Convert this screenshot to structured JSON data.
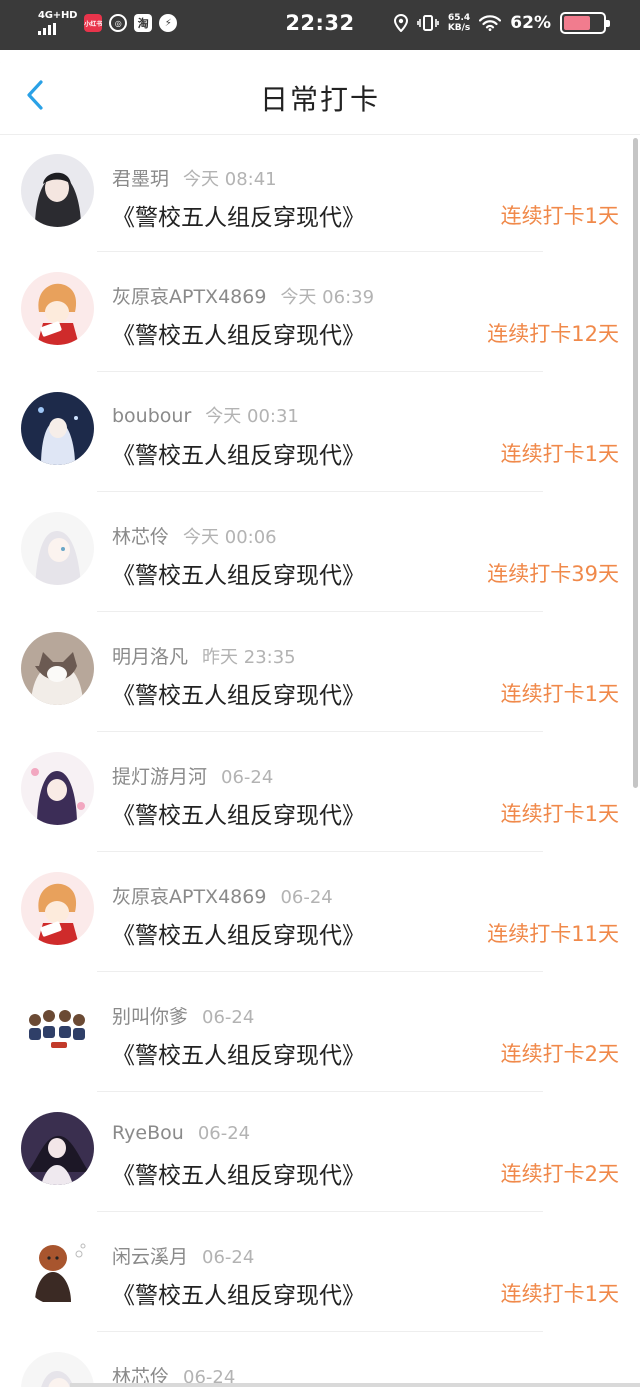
{
  "status_bar": {
    "network": "4G+HD",
    "app_icons": [
      "小红书",
      "◎",
      "淘",
      "⚡"
    ],
    "time": "22:32",
    "speed_value": "65.4",
    "speed_unit": "KB/s",
    "battery_pct": "62%"
  },
  "header": {
    "title": "日常打卡",
    "back_icon": "chevron-left-icon"
  },
  "colors": {
    "accent": "#2aa1e6",
    "streak": "#f0894a",
    "username": "#8a8a8a",
    "time": "#b3b3b3"
  },
  "entries": [
    {
      "user": "君墨玥",
      "time": "今天 08:41",
      "book": "《警校五人组反穿现代》",
      "streak": "连续打卡1天"
    },
    {
      "user": "灰原哀APTX4869",
      "time": "今天 06:39",
      "book": "《警校五人组反穿现代》",
      "streak": "连续打卡12天"
    },
    {
      "user": "boubour",
      "time": "今天 00:31",
      "book": "《警校五人组反穿现代》",
      "streak": "连续打卡1天"
    },
    {
      "user": "林芯伶",
      "time": "今天 00:06",
      "book": "《警校五人组反穿现代》",
      "streak": "连续打卡39天"
    },
    {
      "user": "明月洛凡",
      "time": "昨天 23:35",
      "book": "《警校五人组反穿现代》",
      "streak": "连续打卡1天"
    },
    {
      "user": "提灯游月河",
      "time": "06-24",
      "book": "《警校五人组反穿现代》",
      "streak": "连续打卡1天"
    },
    {
      "user": "灰原哀APTX4869",
      "time": "06-24",
      "book": "《警校五人组反穿现代》",
      "streak": "连续打卡11天"
    },
    {
      "user": "别叫你爹",
      "time": "06-24",
      "book": "《警校五人组反穿现代》",
      "streak": "连续打卡2天"
    },
    {
      "user": "RyeBou",
      "time": "06-24",
      "book": "《警校五人组反穿现代》",
      "streak": "连续打卡2天"
    },
    {
      "user": "闲云溪月",
      "time": "06-24",
      "book": "《警校五人组反穿现代》",
      "streak": "连续打卡1天"
    },
    {
      "user": "林芯伶",
      "time": "06-24",
      "book": "",
      "streak": ""
    }
  ]
}
